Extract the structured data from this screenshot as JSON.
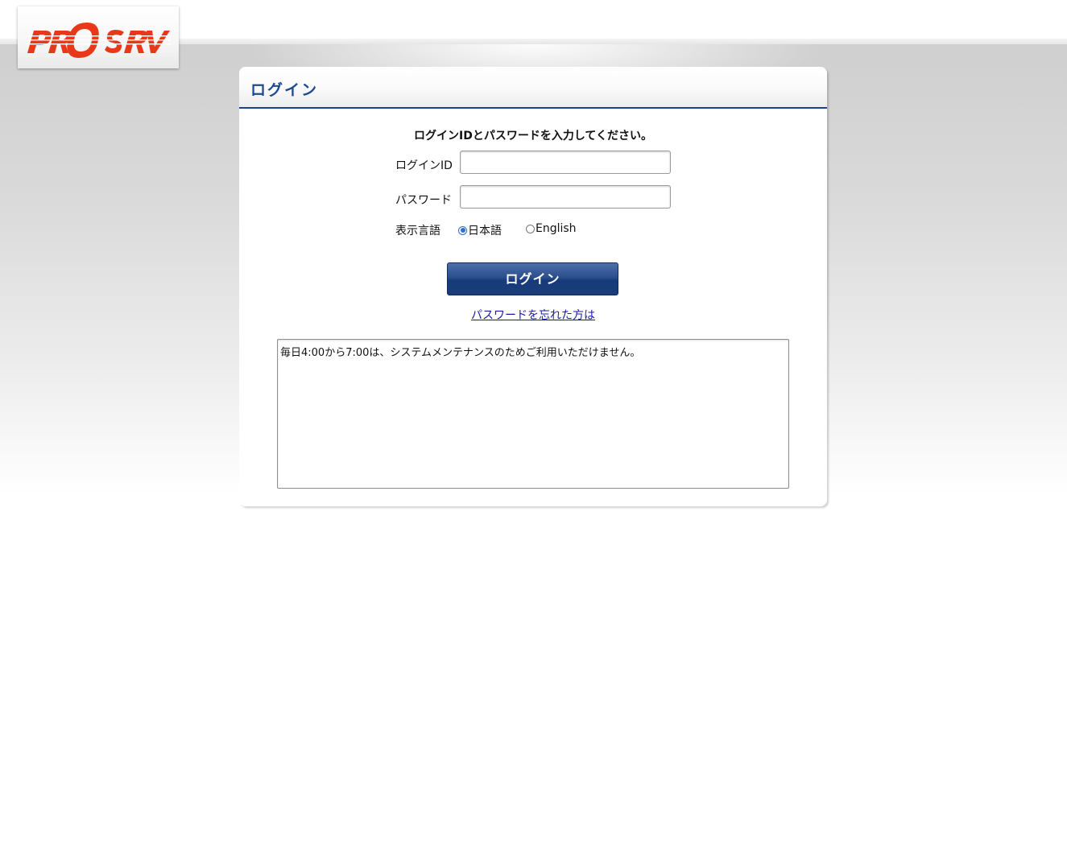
{
  "brand": {
    "logo_text": "PROSRV",
    "logo_color": "#e8381a"
  },
  "panel": {
    "title": "ログイン",
    "instruction": "ログインIDとパスワードを入力してください。",
    "accent_color": "#1b4484"
  },
  "form": {
    "login_id_label": "ログインID",
    "login_id_value": "",
    "password_label": "パスワード",
    "password_value": "",
    "language_label": "表示言語",
    "language_options": [
      {
        "label": "日本語",
        "selected": true
      },
      {
        "label": "English",
        "selected": false
      }
    ],
    "login_button": "ログイン",
    "forgot_link": "パスワードを忘れた方は"
  },
  "notice": {
    "text": "毎日4:00から7:00は、システムメンテナンスのためご利用いただけません。"
  }
}
